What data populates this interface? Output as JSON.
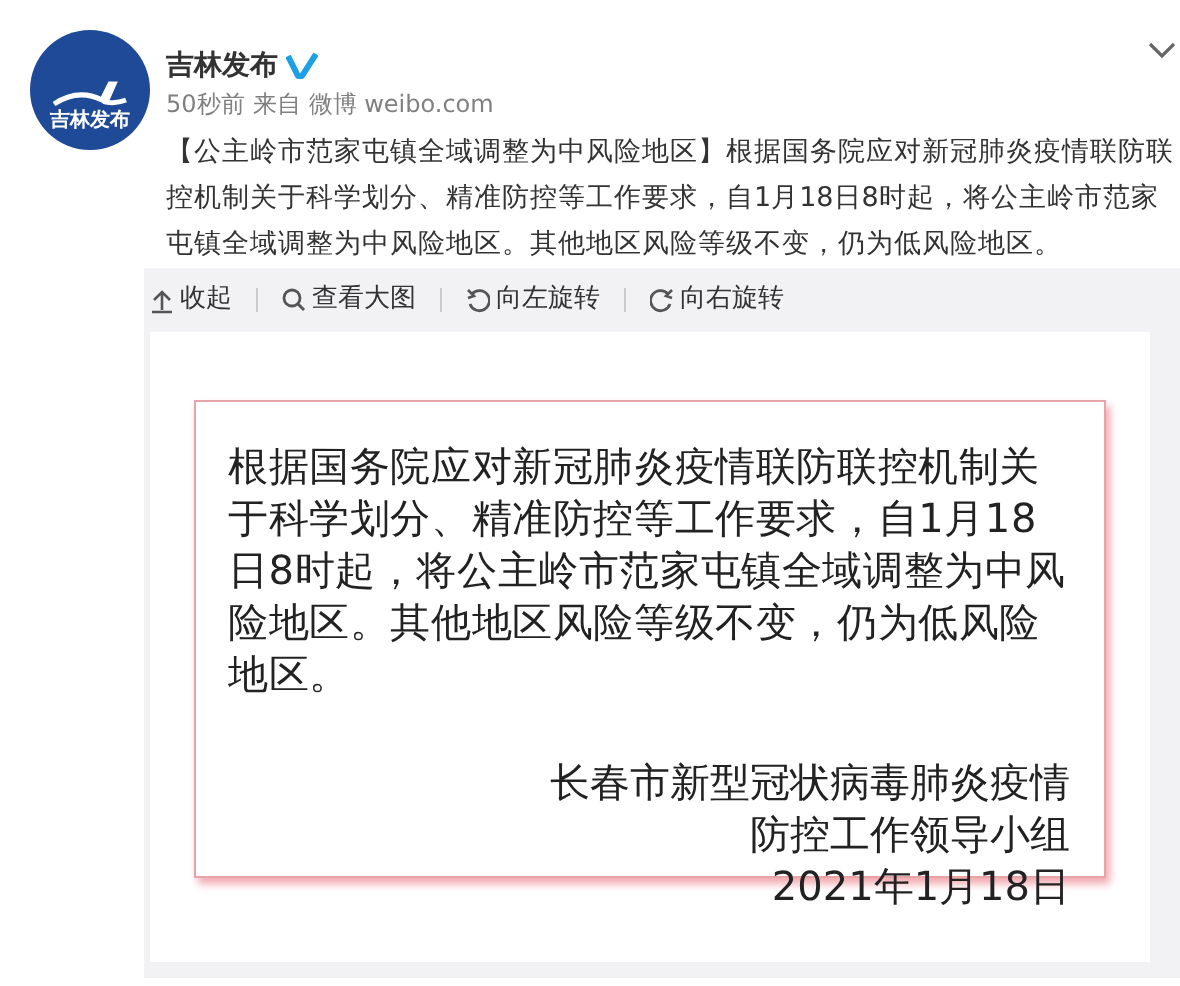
{
  "account": {
    "avatar_label": "吉林发布",
    "name": "吉林发布",
    "verified": true,
    "time": "50秒前",
    "source_prefix": "来自",
    "source": "微博 weibo.com"
  },
  "post": {
    "text": "【公主岭市范家屯镇全域调整为中风险地区】根据国务院应对新冠肺炎疫情联防联控机制关于科学划分、精准防控等工作要求，自1月18日8时起，将公主岭市范家屯镇全域调整为中风险地区。其他地区风险等级不变，仍为低风险地区。"
  },
  "toolbar": [
    {
      "kind": "collapse",
      "label": "收起"
    },
    {
      "kind": "zoom",
      "label": "查看大图"
    },
    {
      "kind": "rotate-left",
      "label": "向左旋转"
    },
    {
      "kind": "rotate-right",
      "label": "向右旋转"
    }
  ],
  "notice": {
    "body": "根据国务院应对新冠肺炎疫情联防联控机制关于科学划分、精准防控等工作要求，自1月18日8时起，将公主岭市范家屯镇全域调整为中风险地区。其他地区风险等级不变，仍为低风险地区。",
    "signature": [
      "长春市新型冠状病毒肺炎疫情",
      "防控工作领导小组",
      "2021年1月18日"
    ]
  }
}
